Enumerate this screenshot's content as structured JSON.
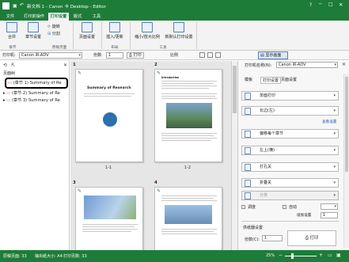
{
  "window": {
    "title": "新文档 1 - Canon 卡 Desktop - Editor"
  },
  "menubar": {
    "tabs": [
      "文件",
      "打印前操作",
      "打印设置",
      "版式",
      "编辑",
      "工具"
    ],
    "active_index": 2
  },
  "ribbon": {
    "buttons": {
      "combine": "合并",
      "chapter_settings": "章节设置",
      "rotate": "旋转",
      "split": "分割",
      "page_layout": "页面设置",
      "insert_blank": "插入/更新",
      "change_size": "缩小/放大比例",
      "default_settings": "新默认打印设置"
    },
    "groups": [
      "章节",
      "原稿页面",
      "布局",
      "工具"
    ]
  },
  "printbar": {
    "printer_label": "打印机:",
    "printer_value": "Canon iR-ADV",
    "copies_label": "份数:",
    "copies_value": "1",
    "print_label": "打印",
    "zoom_label": "比例",
    "show_settings_label": "显示画面"
  },
  "leftpane": {
    "tab_label": "页面树",
    "items": [
      "(章节 1) Summary of Re",
      "(章节 2) Summary of Re",
      "(章节 3) Summary of Re"
    ]
  },
  "pages": [
    {
      "number": "1",
      "label": "1-1",
      "heading": "Summary of Research"
    },
    {
      "number": "2",
      "label": "1-2",
      "heading": "Introduction"
    },
    {
      "number": "3",
      "label": ""
    },
    {
      "number": "4",
      "label": ""
    }
  ],
  "rightpane": {
    "printer_label": "打印机名称(N):",
    "printer_value": "Canon iR-ADV",
    "tabs": [
      "模板",
      "打印设置",
      "页面设置"
    ],
    "active_tab_index": 1,
    "fields": [
      "单面打印",
      "长边(左)",
      "偏移每个章节",
      "左上(横)",
      "打孔关",
      "折叠关",
      "分类"
    ],
    "links": [
      "查看设置"
    ],
    "checkbox_labels": [
      "调度",
      "自动"
    ],
    "paper_source_label": "纸张设置",
    "paper_source_value": "1",
    "output_section_label": "供纸器设置",
    "copies_label": "份数(C):",
    "copies_value": "1",
    "print_button": "打印"
  },
  "statusbar": {
    "total_pages": "原稿页面: 33",
    "output_size": "输出纸大小: A4",
    "output_pages": "打印页数: 33",
    "zoom_value": "25%"
  },
  "colors": {
    "accent": "#1e7c39",
    "selection": "#000000"
  }
}
